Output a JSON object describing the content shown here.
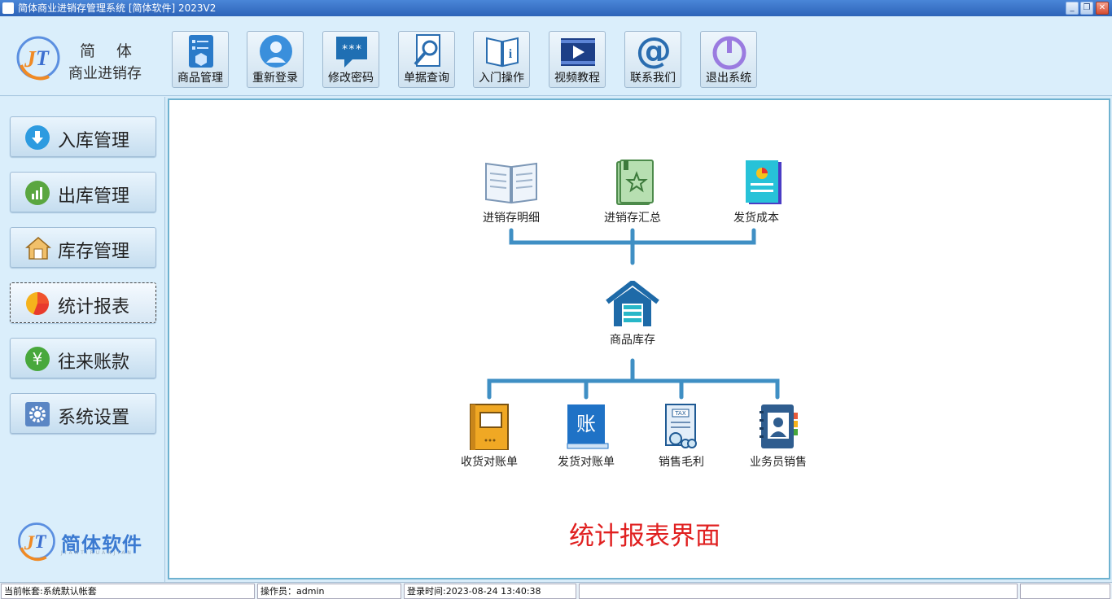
{
  "window": {
    "title": "简体商业进销存管理系统 [简体软件] 2023V2"
  },
  "brand": {
    "line1": "简 体",
    "line2": "商业进销存"
  },
  "toolbar": [
    {
      "label": "商品管理",
      "icon": "product-icon"
    },
    {
      "label": "重新登录",
      "icon": "user-icon"
    },
    {
      "label": "修改密码",
      "icon": "password-icon"
    },
    {
      "label": "单据查询",
      "icon": "search-doc-icon"
    },
    {
      "label": "入门操作",
      "icon": "info-book-icon"
    },
    {
      "label": "视频教程",
      "icon": "video-icon"
    },
    {
      "label": "联系我们",
      "icon": "at-icon"
    },
    {
      "label": "退出系统",
      "icon": "power-icon"
    }
  ],
  "sidebar": {
    "items": [
      {
        "label": "入库管理",
        "icon": "arrow-down-icon",
        "color": "#2d9be0"
      },
      {
        "label": "出库管理",
        "icon": "chart-up-icon",
        "color": "#5aa640"
      },
      {
        "label": "库存管理",
        "icon": "warehouse-icon",
        "color": "#e8a33a"
      },
      {
        "label": "统计报表",
        "icon": "pie-chart-icon",
        "color": "#f0522d"
      },
      {
        "label": "往来账款",
        "icon": "yen-icon",
        "color": "#48a83c"
      },
      {
        "label": "系统设置",
        "icon": "gear-icon",
        "color": "#5a86c4"
      }
    ],
    "logo_text": "简体软件",
    "logo_sub": "JIANTIRUANJIAN"
  },
  "main": {
    "top_nodes": [
      {
        "label": "进销存明细",
        "icon": "open-book-icon"
      },
      {
        "label": "进销存汇总",
        "icon": "star-book-icon"
      },
      {
        "label": "发货成本",
        "icon": "report-icon"
      }
    ],
    "center_node": {
      "label": "商品库存",
      "icon": "warehouse-icon"
    },
    "bottom_nodes": [
      {
        "label": "收货对账单",
        "icon": "orange-book-icon"
      },
      {
        "label": "发货对账单",
        "icon": "ledger-book-icon"
      },
      {
        "label": "销售毛利",
        "icon": "tax-doc-icon"
      },
      {
        "label": "业务员销售",
        "icon": "contact-book-icon"
      }
    ],
    "caption": "统计报表界面"
  },
  "status": {
    "account": "当前帐套:系统默认帐套",
    "operator": "操作员：admin",
    "login_time": "登录时间:2023-08-24 13:40:38"
  },
  "colors": {
    "accent": "#2d63b8",
    "connector": "#3f8fc4",
    "caption": "#e02020"
  }
}
